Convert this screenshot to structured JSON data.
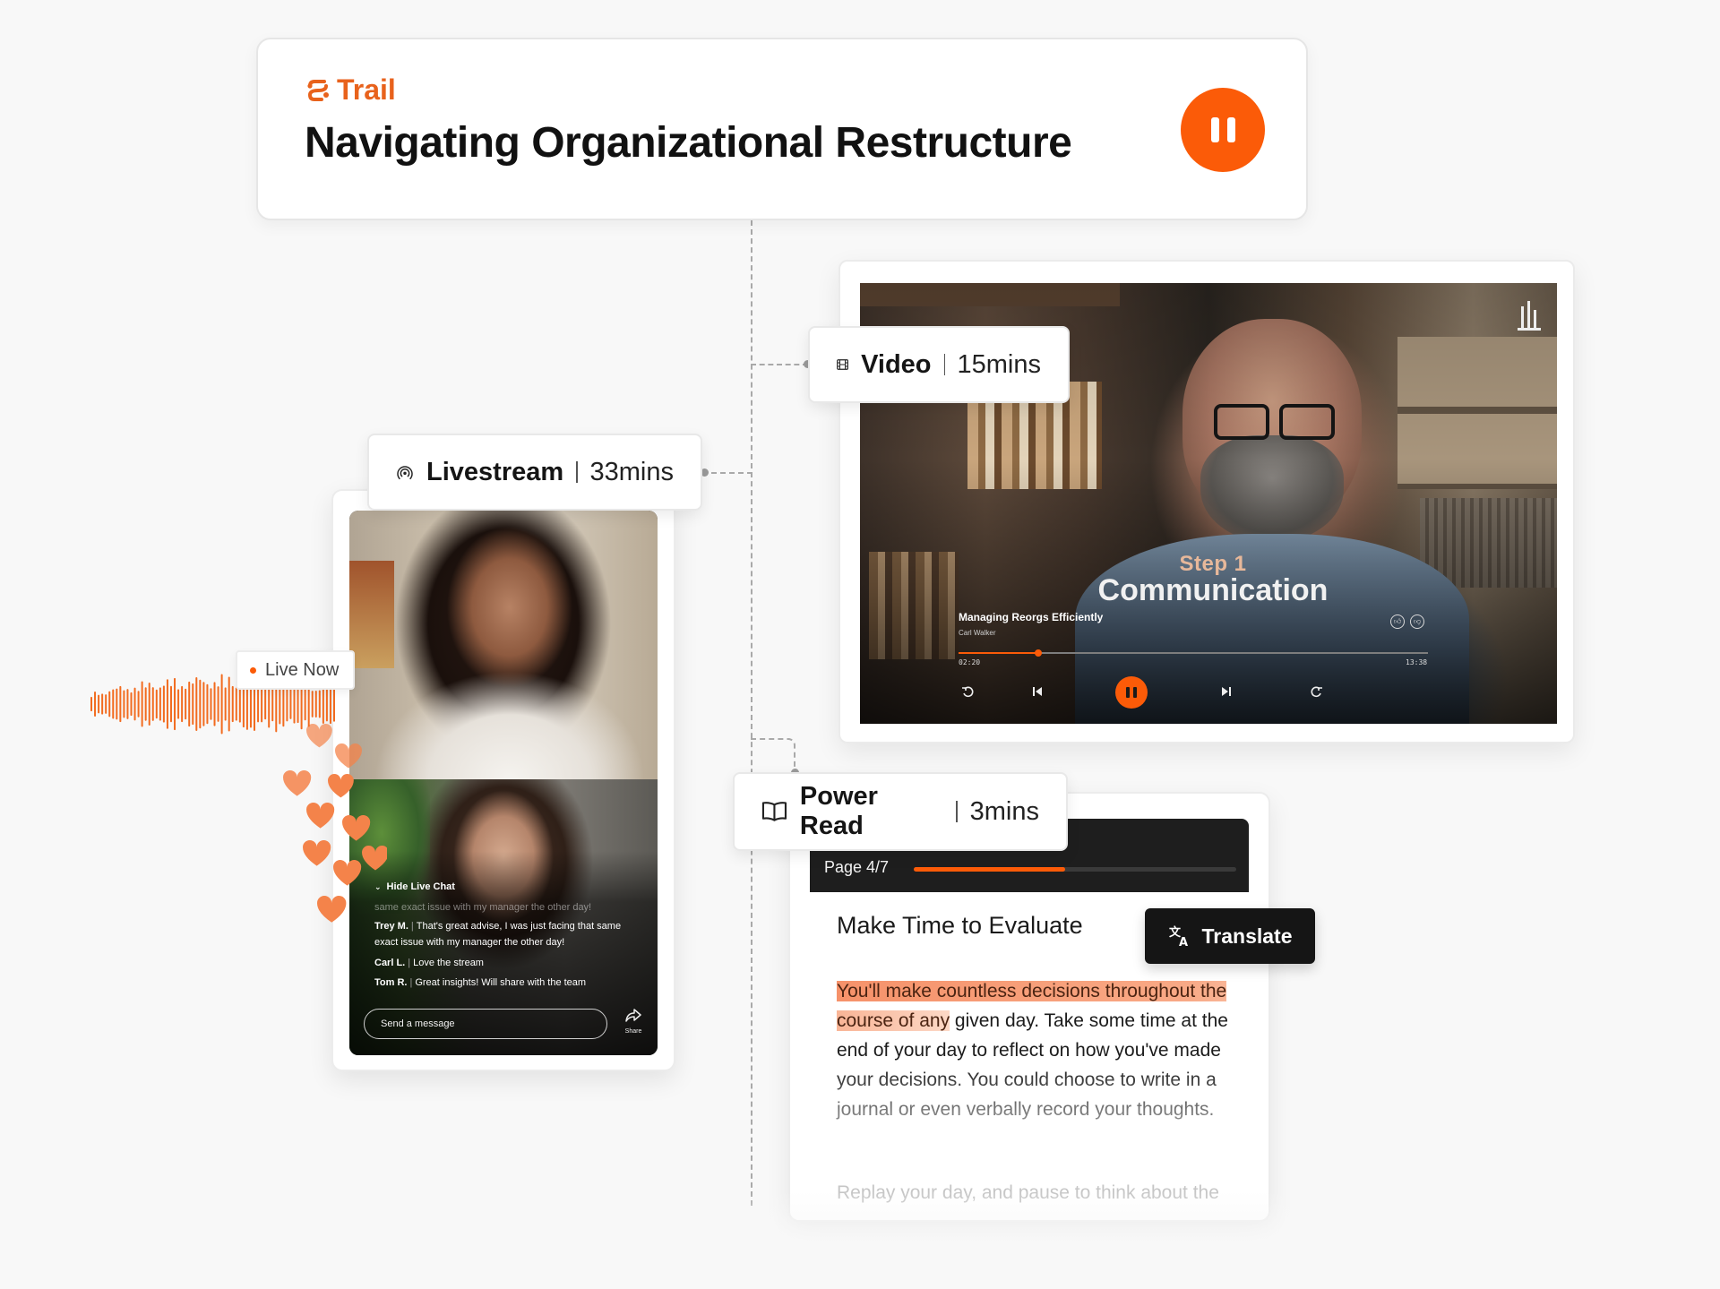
{
  "brand": {
    "name": "Trail",
    "accent": "#fb5b08"
  },
  "header": {
    "title": "Navigating Organizational Restructure",
    "control": "pause"
  },
  "video": {
    "chip_label": "Video",
    "duration": "15mins",
    "step_label": "Step 1",
    "step_title": "Communication",
    "video_name": "Managing Reorgs Efficiently",
    "author": "Carl Walker",
    "time_current": "02:20",
    "time_total": "13:38",
    "progress": 0.17
  },
  "livestream": {
    "chip_label": "Livestream",
    "duration": "33mins",
    "live_badge": "Live Now",
    "chat_toggle": "Hide Live Chat",
    "chat_faded": "same exact issue with my manager the other day!",
    "messages": [
      {
        "user": "Trey M.",
        "text": "That's great advise, I was just facing that same exact issue with my manager the other day!"
      },
      {
        "user": "Carl L.",
        "text": "Love the stream"
      },
      {
        "user": "Tom R.",
        "text": "Great insights! Will share with the team"
      }
    ],
    "input_placeholder": "Send a message",
    "share_label": "Share"
  },
  "power_read": {
    "chip_label": "Power Read",
    "duration": "3mins",
    "page_label": "Page 4/7",
    "page_progress": 0.47,
    "title": "Make Time to Evaluate",
    "highlight": "You'll make countless decisions throughout the course of any",
    "body": " given day. Take some time at the end of your day to reflect on how you've made your decisions. You could choose to write in a journal or even verbally record your thoughts.",
    "next": "Replay your day, and pause to think about the",
    "translate_label": "Translate"
  }
}
